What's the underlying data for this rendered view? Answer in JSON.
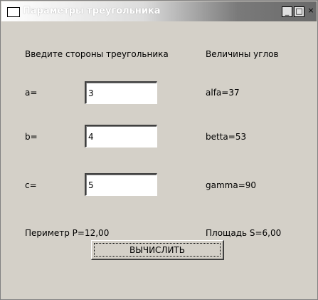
{
  "window": {
    "title": "Параметры треугольника",
    "controls": {
      "minimize": "_",
      "maximize": "□",
      "close": "×"
    }
  },
  "sides": {
    "heading": "Введите стороны треугольника",
    "a_label": "a=",
    "a_value": "3",
    "b_label": "b=",
    "b_value": "4",
    "c_label": "c=",
    "c_value": "5"
  },
  "angles": {
    "heading": "Величины углов",
    "alfa": "alfa=37",
    "betta": "betta=53",
    "gamma": "gamma=90"
  },
  "results": {
    "perimeter": "Периметр P=12,00",
    "area": "Площадь S=6,00"
  },
  "actions": {
    "calculate_label": "ВЫЧИСЛИТЬ"
  }
}
